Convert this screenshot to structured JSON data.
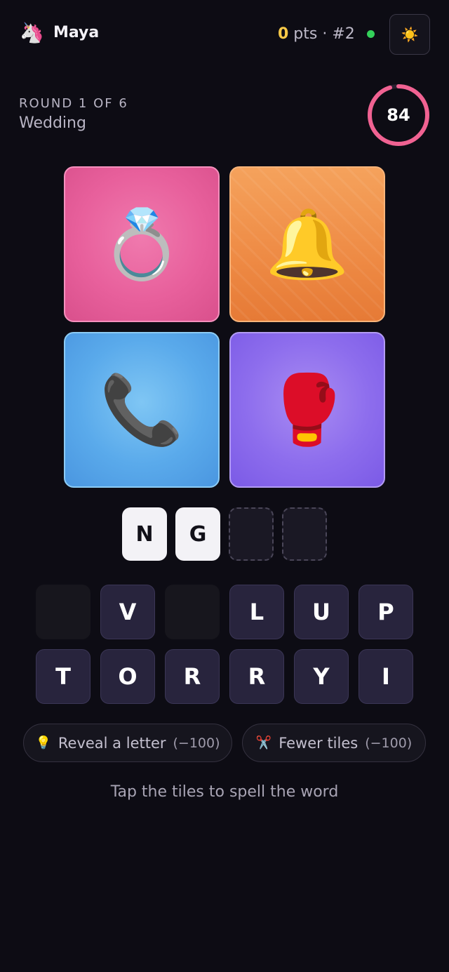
{
  "header": {
    "avatar_emoji": "🦄",
    "player_name": "Maya",
    "points": "0",
    "points_suffix": " pts · #2",
    "online_color": "#34d15a",
    "theme_icon": "☀️"
  },
  "round": {
    "label": "ROUND 1 OF 6",
    "topic": "Wedding",
    "timer": "84"
  },
  "clues": [
    {
      "emoji": "💍",
      "name": "ring"
    },
    {
      "emoji": "🔔",
      "name": "bell"
    },
    {
      "emoji": "📞",
      "name": "phone"
    },
    {
      "emoji": "🥊",
      "name": "boxing-glove"
    }
  ],
  "answer_slots": [
    "N",
    "G",
    "",
    ""
  ],
  "letter_tiles": [
    [
      "",
      "V",
      "",
      "L",
      "U",
      "P"
    ],
    [
      "T",
      "O",
      "R",
      "R",
      "Y",
      "I"
    ]
  ],
  "hints": {
    "reveal_icon": "💡",
    "reveal_label": "Reveal a letter",
    "reveal_cost": "(−100)",
    "fewer_icon": "✂️",
    "fewer_label": "Fewer tiles",
    "fewer_cost": "(−100)"
  },
  "instruction": "Tap the tiles to spell the word",
  "colors": {
    "background": "#0d0c14",
    "accent_gold": "#f7c948",
    "timer_ring": "#f06292"
  }
}
